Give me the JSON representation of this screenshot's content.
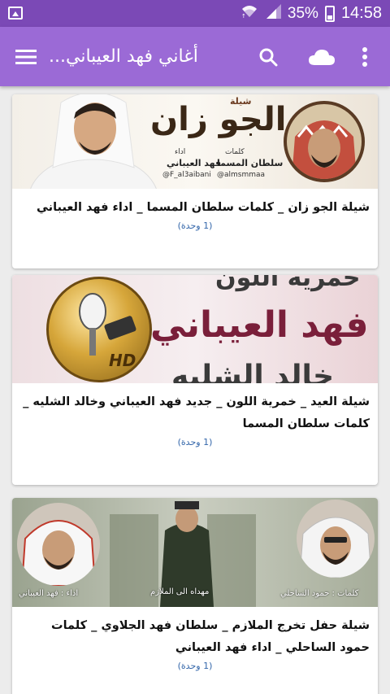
{
  "status_bar": {
    "battery_percent": "35%",
    "time": "14:58",
    "icons": [
      "image-icon",
      "wifi-icon",
      "signal-icon",
      "battery-icon"
    ]
  },
  "app_bar": {
    "title": "أغاني فهد العيباني...",
    "icons": [
      "more-vert-icon",
      "cloud-icon",
      "search-icon",
      "menu-icon"
    ]
  },
  "cards": [
    {
      "title": "شيلة الجو زان _ كلمات سلطان المسما _ اداء فهد العيباني",
      "count": "(1 وحدة)",
      "image": {
        "big_text": "الجو زان",
        "small_label": "شيلة",
        "credit_right_label": "كلمات",
        "credit_right_name": "سلطان المسما",
        "credit_right_handle": "@almsmmaa",
        "credit_left_label": "اداء",
        "credit_left_name": "فهد العيباني",
        "credit_left_handle": "@F_al3aibani"
      }
    },
    {
      "title": "شيلة العيد _ خمرية اللون _ جديد فهد العيباني وخالد الشليه _ كلمات سلطان المسما",
      "count": "(1 وحدة)",
      "image": {
        "top_text": "خمرية اللون",
        "main_text": "فهد العيباني",
        "bottom_text": "خالد الشليه",
        "logo_text": "HD"
      }
    },
    {
      "title": "شيلة حفل تخرج الملازم _ سلطان فهد الجلاوي _ كلمات حمود الساحلي _ اداء فهد العيباني",
      "count": "(1 وحدة)",
      "image": {
        "left_caption": "اداء : فهد العيباني",
        "center_caption": "مهداه الى الملازم",
        "right_caption": "كلمات : حمود الساحلي"
      }
    }
  ],
  "colors": {
    "status_bar": "#7b49b6",
    "app_bar": "#9b6ad6",
    "background": "#ececec",
    "count_text": "#3366aa"
  }
}
